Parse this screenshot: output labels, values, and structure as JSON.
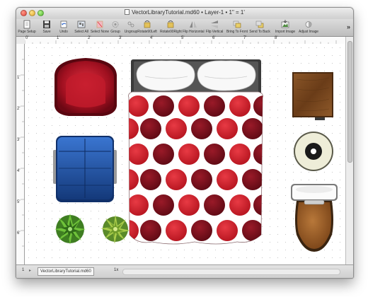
{
  "window": {
    "title": "VectorLibraryTutorial.md60 • Layer-1 • 1\" = 1'"
  },
  "toolbar": {
    "items": [
      {
        "label": "Page Setup",
        "icon": "page-setup-icon"
      },
      {
        "label": "Save",
        "icon": "floppy-icon"
      },
      {
        "label": "Undo",
        "icon": "undo-icon"
      },
      {
        "label": "Select All",
        "icon": "select-all-icon"
      },
      {
        "label": "Select None",
        "icon": "select-none-icon"
      },
      {
        "label": "Group",
        "icon": "group-icon"
      },
      {
        "label": "Ungroup",
        "icon": "ungroup-icon"
      },
      {
        "label": "Rotate90Left",
        "icon": "rotate-left-icon"
      },
      {
        "label": "Rotate90Right",
        "icon": "rotate-right-icon"
      },
      {
        "label": "Flip Horizontal",
        "icon": "flip-horizontal-icon"
      },
      {
        "label": "Flip Vertical",
        "icon": "flip-vertical-icon"
      },
      {
        "label": "Bring To Front",
        "icon": "bring-to-front-icon"
      },
      {
        "label": "Send To Back",
        "icon": "send-to-back-icon"
      },
      {
        "label": "Import Image",
        "icon": "import-image-icon"
      },
      {
        "label": "Adjust Image",
        "icon": "adjust-image-icon"
      }
    ],
    "overflow": "»"
  },
  "rulers": {
    "top_labels": [
      "0'",
      "1'",
      "2'",
      "3'",
      "4'",
      "5'",
      "6'",
      "7'",
      "8'"
    ],
    "left_labels": [
      "1'",
      "2'",
      "3'",
      "4'",
      "5'",
      "6'"
    ]
  },
  "status": {
    "page": "1",
    "file_tab": "VectorLibraryTutorial.md60",
    "zoom": "1x"
  },
  "colors": {
    "armchair": "#a01020",
    "sofa": "#1a4c9c",
    "bed_dot_red": "#d0202e",
    "bed_dot_dark": "#7a0f1c",
    "table": "#7a4a22",
    "toilet_seat": "#9a5a24"
  }
}
